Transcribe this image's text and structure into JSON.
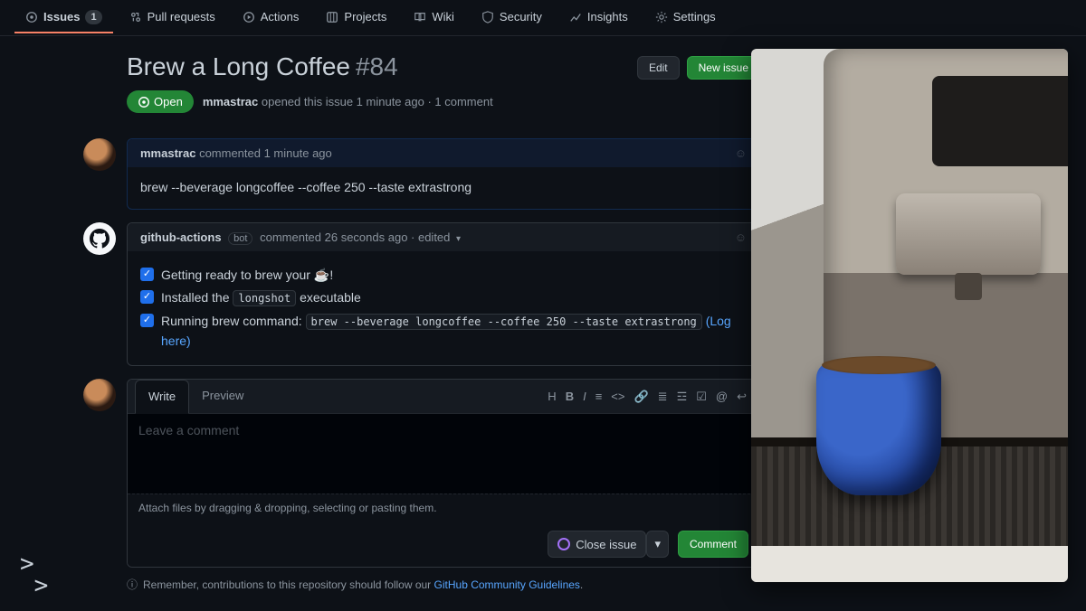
{
  "nav": {
    "items": [
      {
        "label": "Issues",
        "count": "1",
        "icon": "issue"
      },
      {
        "label": "Pull requests",
        "icon": "pr"
      },
      {
        "label": "Actions",
        "icon": "play"
      },
      {
        "label": "Projects",
        "icon": "project"
      },
      {
        "label": "Wiki",
        "icon": "book"
      },
      {
        "label": "Security",
        "icon": "shield"
      },
      {
        "label": "Insights",
        "icon": "graph"
      },
      {
        "label": "Settings",
        "icon": "gear"
      }
    ]
  },
  "issue": {
    "title": "Brew a Long Coffee",
    "number": "#84",
    "edit": "Edit",
    "new": "New issue",
    "state": "Open",
    "opener": "mmastrac",
    "open_text": "opened this issue 1 minute ago · 1 comment"
  },
  "comments": [
    {
      "author": "mmastrac",
      "meta": "commented 1 minute ago",
      "body": "brew --beverage longcoffee --coffee 250 --taste extrastrong"
    },
    {
      "author": "github-actions",
      "bot_label": "bot",
      "meta": "commented 26 seconds ago · edited",
      "check1_pre": "Getting ready to brew your ",
      "check1_post": "!",
      "check2_pre": "Installed the ",
      "check2_code": "longshot",
      "check2_post": " executable",
      "check3_pre": "Running brew command: ",
      "check3_code": "brew --beverage longcoffee --coffee 250 --taste extrastrong",
      "check3_link": "(Log here)"
    }
  ],
  "composer": {
    "write": "Write",
    "preview": "Preview",
    "placeholder": "Leave a comment",
    "attach": "Attach files by dragging & dropping, selecting or pasting them.",
    "close": "Close issue",
    "comment": "Comment"
  },
  "guidelines": {
    "pre": "Remember, contributions to this repository should follow our ",
    "link": "GitHub Community Guidelines",
    "post": "."
  },
  "toolbar": {
    "h": "H",
    "b": "B",
    "i": "I"
  },
  "prompt": ">\n >"
}
